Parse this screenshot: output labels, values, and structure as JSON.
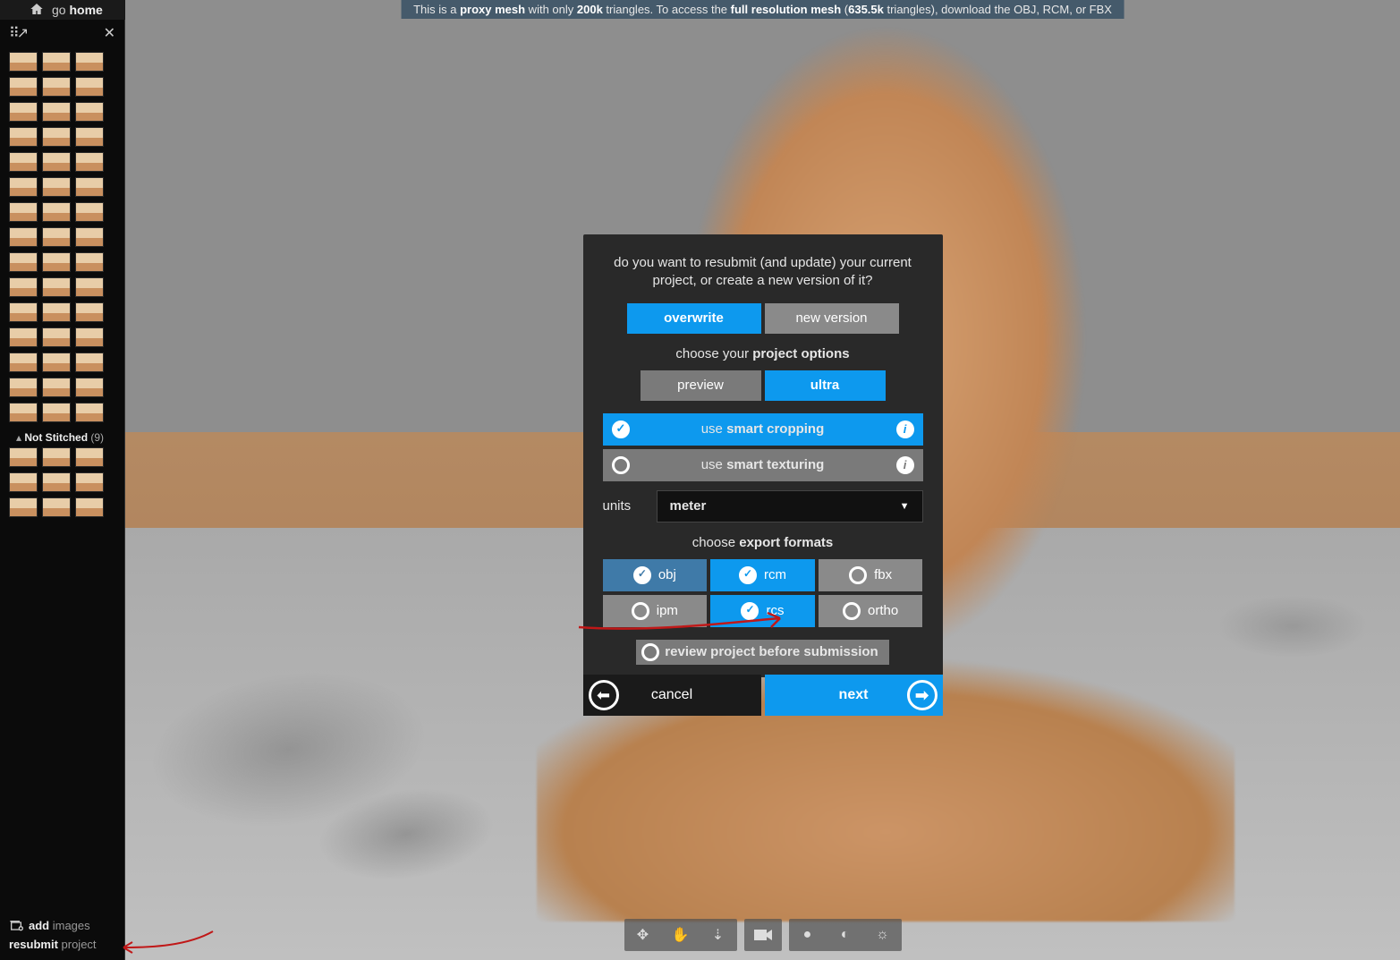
{
  "header": {
    "go": "go ",
    "home": "home"
  },
  "sidebar": {
    "not_stitched_label": "Not Stitched",
    "not_stitched_count": "(9)",
    "add_prefix": "add ",
    "add_suffix": "images",
    "resubmit_prefix": "resubmit ",
    "resubmit_suffix": "project"
  },
  "banner": {
    "p1": "This is a ",
    "b1": "proxy mesh",
    "p2": " with only ",
    "b2": "200k",
    "p3": " triangles. To access the ",
    "b3": "full resolution mesh",
    "p4": " (",
    "b4": "635.5k",
    "p5": " triangles), download the OBJ, RCM, or FBX"
  },
  "modal": {
    "question": "do you want to resubmit (and update) your current project, or create a new version of it?",
    "overwrite": "overwrite",
    "new_version": "new version",
    "choose_opts_pre": "choose your ",
    "choose_opts_b": "project options",
    "preview": "preview",
    "ultra": "ultra",
    "cropping_pre": "use ",
    "cropping_b": "smart cropping",
    "texturing_pre": "use ",
    "texturing_b": "smart texturing",
    "units_label": "units",
    "units_value": "meter",
    "export_pre": "choose ",
    "export_b": "export formats",
    "formats": {
      "obj": "obj",
      "rcm": "rcm",
      "fbx": "fbx",
      "ipm": "ipm",
      "rcs": "rcs",
      "ortho": "ortho"
    },
    "review": "review project before submission",
    "cancel": "cancel",
    "next": "next"
  }
}
